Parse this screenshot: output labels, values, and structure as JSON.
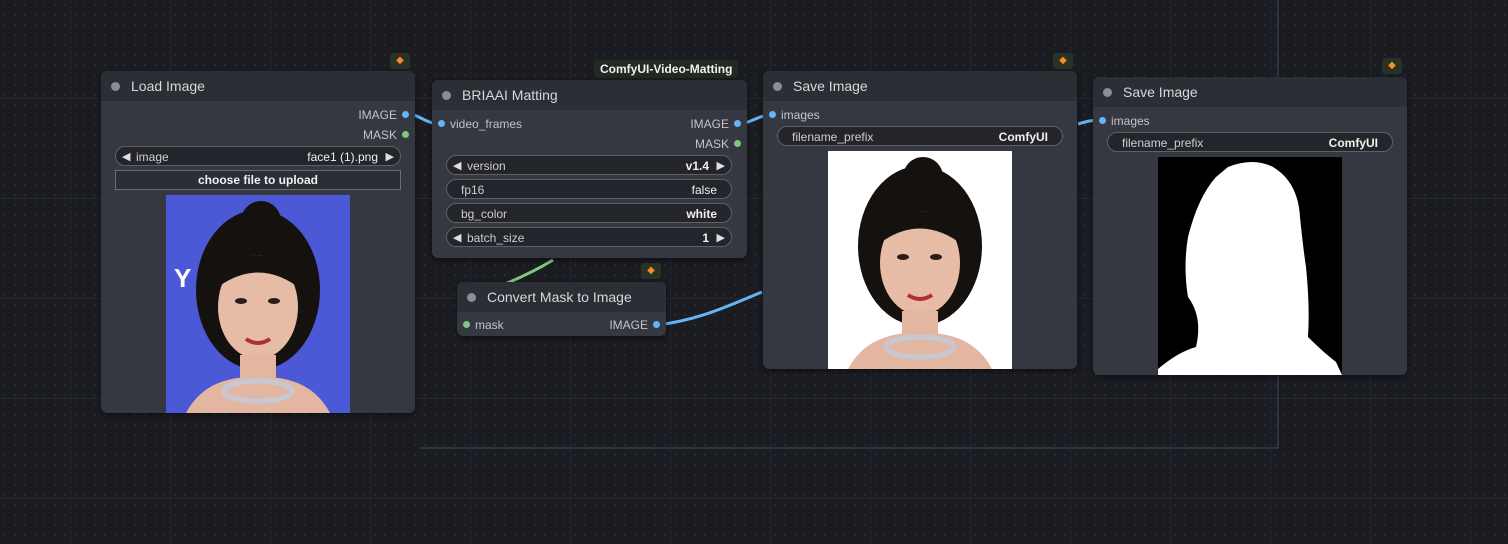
{
  "canvas": {
    "group_label": "ComfyUI-Video-Matting"
  },
  "load_image": {
    "title": "Load Image",
    "outputs": [
      "IMAGE",
      "MASK"
    ],
    "image_widget": {
      "label": "image",
      "value": "face1 (1).png"
    },
    "upload_label": "choose file to upload"
  },
  "matting": {
    "title": "BRIAAI Matting",
    "input": "video_frames",
    "outputs": [
      "IMAGE",
      "MASK"
    ],
    "widgets": [
      {
        "label": "version",
        "value": "v1.4"
      },
      {
        "label": "fp16",
        "value": "false"
      },
      {
        "label": "bg_color",
        "value": "white"
      },
      {
        "label": "batch_size",
        "value": "1"
      }
    ]
  },
  "convert": {
    "title": "Convert Mask to Image",
    "input": "mask",
    "output": "IMAGE"
  },
  "save1": {
    "title": "Save Image",
    "input": "images",
    "prefix_label": "filename_prefix",
    "prefix_value": "ComfyUI"
  },
  "save2": {
    "title": "Save Image",
    "input": "images",
    "prefix_label": "filename_prefix",
    "prefix_value": "ComfyUI"
  },
  "colors": {
    "image_slot": "#64b5f6",
    "mask_slot": "#81c784",
    "node_body": "#353841",
    "node_header": "#2b2e35",
    "badge_fox": "#ff8a1f"
  },
  "icons": {
    "node_status": "circle-dot-icon",
    "badge": "fox-badge-icon",
    "arrow_left": "left-triangle-icon",
    "arrow_right": "right-triangle-icon"
  }
}
